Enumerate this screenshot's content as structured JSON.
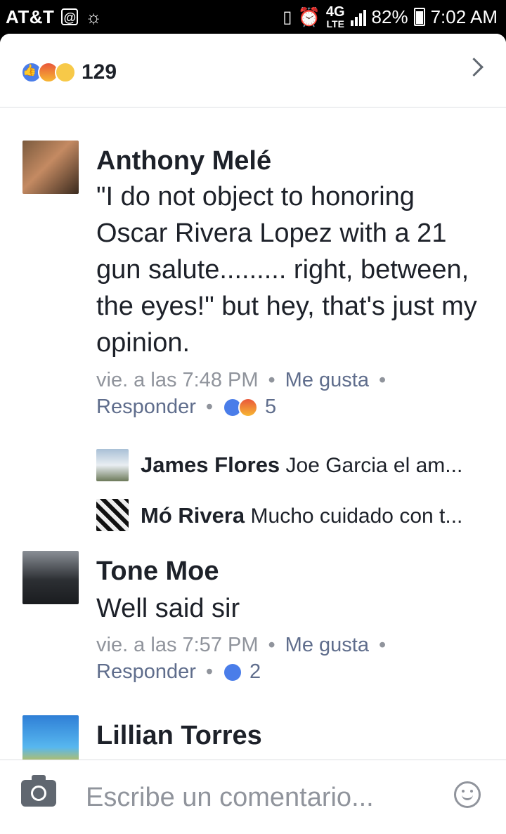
{
  "status_bar": {
    "carrier": "AT&T",
    "at_icon": "@",
    "network": "4G",
    "network_sub": "LTE",
    "battery": "82%",
    "time": "7:02 AM"
  },
  "header": {
    "reaction_count": "129",
    "reactions": [
      "like-icon",
      "angry-icon",
      "sad-icon"
    ]
  },
  "comments": [
    {
      "author": "Anthony Melé",
      "text": "\"I do not object to honoring Oscar Rivera Lopez with a 21 gun salute......... right, between, the eyes!\"    but hey, that's just my opinion.",
      "time": "vie. a las 7:48 PM",
      "like_label": "Me gusta",
      "reply_label": "Responder",
      "reaction_count": "5",
      "replies": [
        {
          "author": "James Flores",
          "text": "Joe Garcia el am..."
        },
        {
          "author": "Mó Rivera",
          "text": "Mucho cuidado con t..."
        }
      ]
    },
    {
      "author": "Tone Moe",
      "text": "Well said sir",
      "time": "vie. a las 7:57 PM",
      "like_label": "Me gusta",
      "reply_label": "Responder",
      "reaction_count": "2"
    },
    {
      "author": "Lillian Torres"
    }
  ],
  "composer": {
    "placeholder": "Escribe un comentario..."
  },
  "colors": {
    "like_blue": "#4a7de9",
    "link_blue": "#5f6d8c",
    "meta_gray": "#90949c",
    "text_dark": "#1d2129"
  }
}
